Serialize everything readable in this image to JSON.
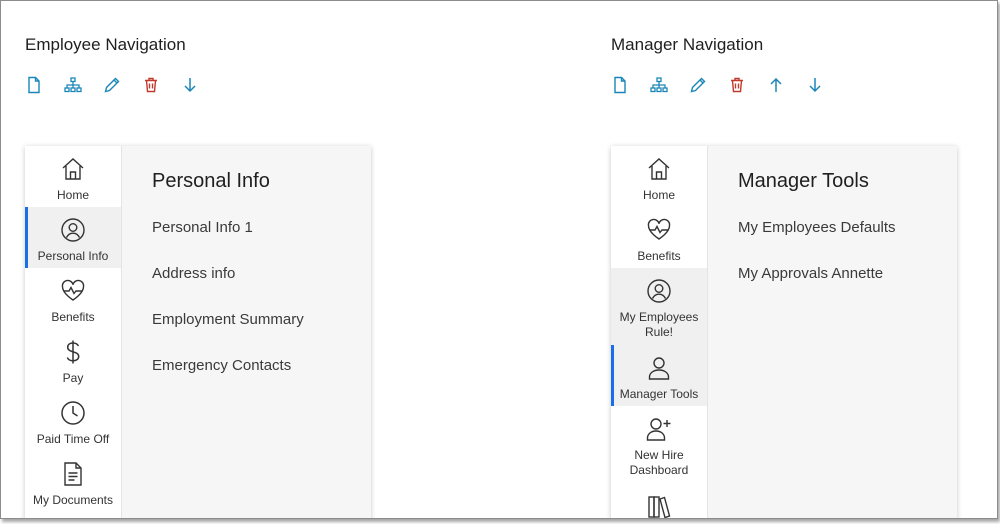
{
  "employee": {
    "title": "Employee Navigation",
    "toolbar": [
      {
        "icon": "new-page-icon",
        "color": "#1a86b8"
      },
      {
        "icon": "hierarchy-icon",
        "color": "#1a86b8"
      },
      {
        "icon": "pencil-icon",
        "color": "#1a86b8"
      },
      {
        "icon": "trash-icon",
        "color": "#c0392b"
      },
      {
        "icon": "arrow-down-icon",
        "color": "#1a86b8"
      }
    ],
    "rail": [
      {
        "label": "Home",
        "icon": "home-icon"
      },
      {
        "label": "Personal Info",
        "icon": "user-circle-icon",
        "active": true
      },
      {
        "label": "Benefits",
        "icon": "heart-pulse-icon"
      },
      {
        "label": "Pay",
        "icon": "dollar-icon"
      },
      {
        "label": "Paid Time Off",
        "icon": "clock-icon"
      },
      {
        "label": "My Documents",
        "icon": "document-icon"
      }
    ],
    "content_title": "Personal Info",
    "links": [
      "Personal Info 1",
      "Address info",
      "Employment Summary",
      "Emergency Contacts"
    ]
  },
  "manager": {
    "title": "Manager Navigation",
    "toolbar": [
      {
        "icon": "new-page-icon",
        "color": "#1a86b8"
      },
      {
        "icon": "hierarchy-icon",
        "color": "#1a86b8"
      },
      {
        "icon": "pencil-icon",
        "color": "#1a86b8"
      },
      {
        "icon": "trash-icon",
        "color": "#c0392b"
      },
      {
        "icon": "arrow-up-icon",
        "color": "#1a86b8"
      },
      {
        "icon": "arrow-down-icon",
        "color": "#1a86b8"
      }
    ],
    "rail": [
      {
        "label": "Home",
        "icon": "home-icon"
      },
      {
        "label": "Benefits",
        "icon": "heart-pulse-icon"
      },
      {
        "label": "My Employees Rule!",
        "icon": "user-circle-icon",
        "hover": true
      },
      {
        "label": "Manager Tools",
        "icon": "person-icon",
        "active": true
      },
      {
        "label": "New Hire Dashboard",
        "icon": "person-add-icon"
      },
      {
        "label": "",
        "icon": "books-icon"
      }
    ],
    "content_title": "Manager Tools",
    "links": [
      "My Employees Defaults",
      "My Approvals Annette"
    ]
  },
  "colors": {
    "accent": "#1a6fe8",
    "tool_blue": "#1a86b8",
    "tool_red": "#c0392b"
  }
}
